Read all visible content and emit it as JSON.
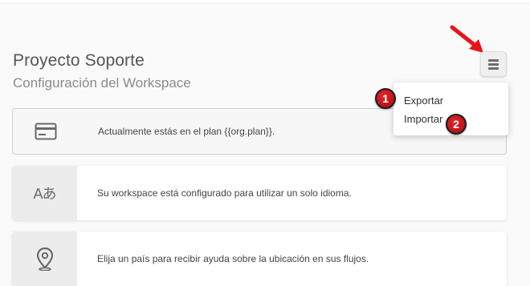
{
  "header": {
    "title": "Proyecto Soporte",
    "subtitle": "Configuración del Workspace"
  },
  "menu": {
    "button_icon": "hamburger-menu-icon",
    "items": [
      {
        "label": "Exportar"
      },
      {
        "label": "Importar"
      }
    ]
  },
  "annotations": {
    "badge_1": "1",
    "badge_2": "2",
    "arrow_color": "#e8141b",
    "badge_color": "#c4141a"
  },
  "cards": [
    {
      "icon": "credit-card-icon",
      "text": "Actualmente estás en el plan {{org.plan}}."
    },
    {
      "icon": "language-translate-icon",
      "icon_text": "Aあ",
      "text": "Su workspace está configurado para utilizar un solo idioma."
    },
    {
      "icon": "location-pin-icon",
      "text": "Elija un país para recibir ayuda sobre la ubicación en sus flujos."
    }
  ]
}
